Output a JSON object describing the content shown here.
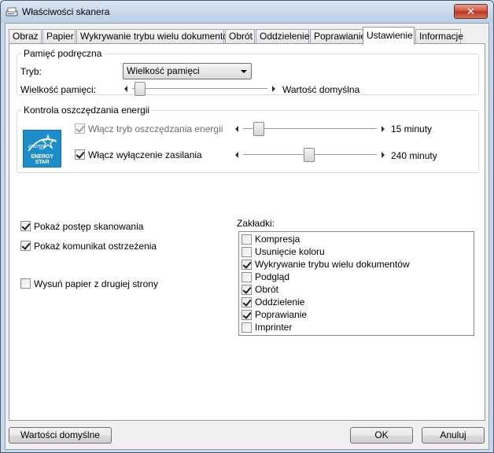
{
  "window": {
    "title": "Właściwości skanera"
  },
  "tabs": [
    {
      "label": "Obraz"
    },
    {
      "label": "Papier"
    },
    {
      "label": "Wykrywanie trybu wielu dokumentów"
    },
    {
      "label": "Obrót"
    },
    {
      "label": "Oddzielenie"
    },
    {
      "label": "Poprawianie"
    },
    {
      "label": "Ustawienie",
      "active": true
    },
    {
      "label": "Informacje"
    }
  ],
  "cache": {
    "group_title": "Pamięć podręczna",
    "mode_label": "Tryb:",
    "mode_value": "Wielkość pamięci",
    "size_label": "Wielkość pamięci:",
    "size_value": "Wartość domyślna"
  },
  "energy": {
    "group_title": "Kontrola oszczędzania energii",
    "logo_text": "ENERGY STAR",
    "sleep_label": "Włącz tryb oszczędzania energii",
    "sleep_checked": true,
    "sleep_enabled": false,
    "sleep_value": "15 minuty",
    "power_label": "Włącz wyłączenie zasilania",
    "power_checked": true,
    "power_value": "240 minuty"
  },
  "options": {
    "show_progress": "Pokaż postęp skanowania",
    "show_warning": "Pokaż komunikat ostrzeżenia",
    "eject_back": "Wysuń papier z drugiej strony"
  },
  "bookmarks": {
    "label": "Zakładki:",
    "items": [
      {
        "label": "Kompresja",
        "checked": false
      },
      {
        "label": "Usunięcie koloru",
        "checked": false
      },
      {
        "label": "Wykrywanie trybu wielu dokumentów",
        "checked": true
      },
      {
        "label": "Podgląd",
        "checked": false
      },
      {
        "label": "Obrót",
        "checked": true
      },
      {
        "label": "Oddzielenie",
        "checked": true
      },
      {
        "label": "Poprawianie",
        "checked": true
      },
      {
        "label": "Imprinter",
        "checked": false
      }
    ]
  },
  "buttons": {
    "defaults": "Wartości domyślne",
    "ok": "OK",
    "cancel": "Anuluj"
  }
}
